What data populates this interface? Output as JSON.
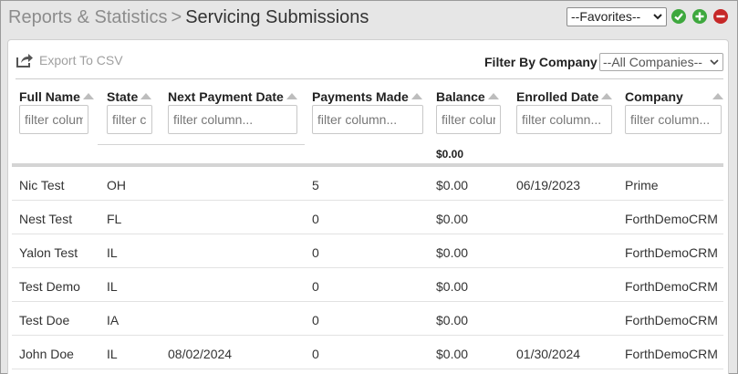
{
  "header": {
    "crumb": "Reports & Statistics",
    "separator": ">",
    "title": "Servicing Submissions",
    "favorites_label": "--Favorites--"
  },
  "toolbar": {
    "export_label": "Export To CSV",
    "filter_label": "Filter By Company",
    "company_selected": "--All Companies--"
  },
  "columns": {
    "full_name": {
      "label": "Full Name",
      "placeholder": "filter column..."
    },
    "state": {
      "label": "State",
      "placeholder": "filter column..."
    },
    "next_payment": {
      "label": "Next Payment Date",
      "placeholder": "filter column..."
    },
    "payments_made": {
      "label": "Payments Made",
      "placeholder": "filter column..."
    },
    "balance": {
      "label": "Balance",
      "placeholder": "filter column..."
    },
    "enrolled": {
      "label": "Enrolled Date",
      "placeholder": "filter column..."
    },
    "company": {
      "label": "Company",
      "placeholder": "filter column..."
    }
  },
  "totals": {
    "balance": "$0.00"
  },
  "rows": [
    {
      "name": "Nic Test",
      "state": "OH",
      "next_payment": "",
      "payments": "5",
      "balance": "$0.00",
      "enrolled": "06/19/2023",
      "company": "Prime"
    },
    {
      "name": "Nest Test",
      "state": "FL",
      "next_payment": "",
      "payments": "0",
      "balance": "$0.00",
      "enrolled": "",
      "company": "ForthDemoCRM"
    },
    {
      "name": "Yalon Test",
      "state": "IL",
      "next_payment": "",
      "payments": "0",
      "balance": "$0.00",
      "enrolled": "",
      "company": "ForthDemoCRM"
    },
    {
      "name": "Test Demo",
      "state": "IL",
      "next_payment": "",
      "payments": "0",
      "balance": "$0.00",
      "enrolled": "",
      "company": "ForthDemoCRM"
    },
    {
      "name": "Test Doe",
      "state": "IA",
      "next_payment": "",
      "payments": "0",
      "balance": "$0.00",
      "enrolled": "",
      "company": "ForthDemoCRM"
    },
    {
      "name": "John Doe",
      "state": "IL",
      "next_payment": "08/02/2024",
      "payments": "0",
      "balance": "$0.00",
      "enrolled": "01/30/2024",
      "company": "ForthDemoCRM"
    }
  ],
  "colors": {
    "green": "#3ea83e",
    "red": "#c62828"
  }
}
